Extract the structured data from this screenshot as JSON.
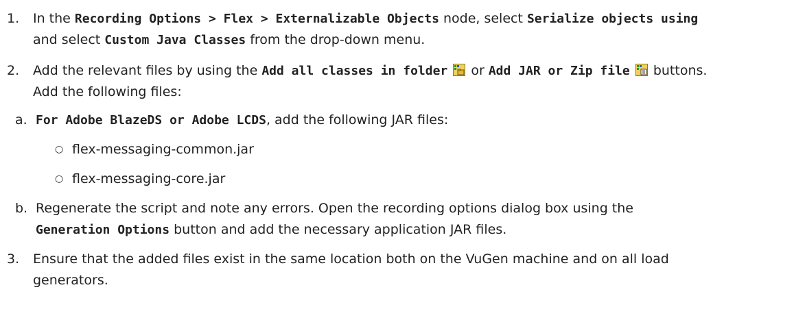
{
  "steps": [
    {
      "number": "1.",
      "line1_pre": "In the ",
      "path": "Recording Options > Flex > Externalizable Objects",
      "line1_mid": " node, select ",
      "option": "Serialize objects using",
      "line2_pre": "and select ",
      "choice": "Custom Java Classes",
      "line2_post": " from the drop-down menu."
    },
    {
      "number": "2.",
      "pre": "Add the relevant files by using the ",
      "btn_folder": "Add all classes in folder",
      "icon_folder": "add-classes-folder-icon",
      "or": " or ",
      "btn_jar": "Add JAR or Zip file",
      "icon_jar": "add-jar-zip-icon",
      "post": " buttons.",
      "line2": "Add the following files:",
      "sub": [
        {
          "letter": "a.",
          "bold": "For Adobe BlazeDS or Adobe LCDS",
          "text": ", add the following JAR files:",
          "bullets": [
            "flex-messaging-common.jar",
            "flex-messaging-core.jar"
          ]
        },
        {
          "letter": "b.",
          "line1": "Regenerate the script and note any errors. Open the recording options dialog box using the",
          "bold": "Generation Options",
          "line2_post": " button and add the necessary application JAR files."
        }
      ]
    },
    {
      "number": "3.",
      "line1": "Ensure that the added files exist in the same location both on the VuGen machine and on all load",
      "line2": "generators."
    }
  ],
  "bullet_glyph": "○",
  "colors": {
    "text": "#222222",
    "icon_bg": "#f0d060",
    "icon_green": "#2a9a2a",
    "icon_blue": "#1f5fbf"
  }
}
